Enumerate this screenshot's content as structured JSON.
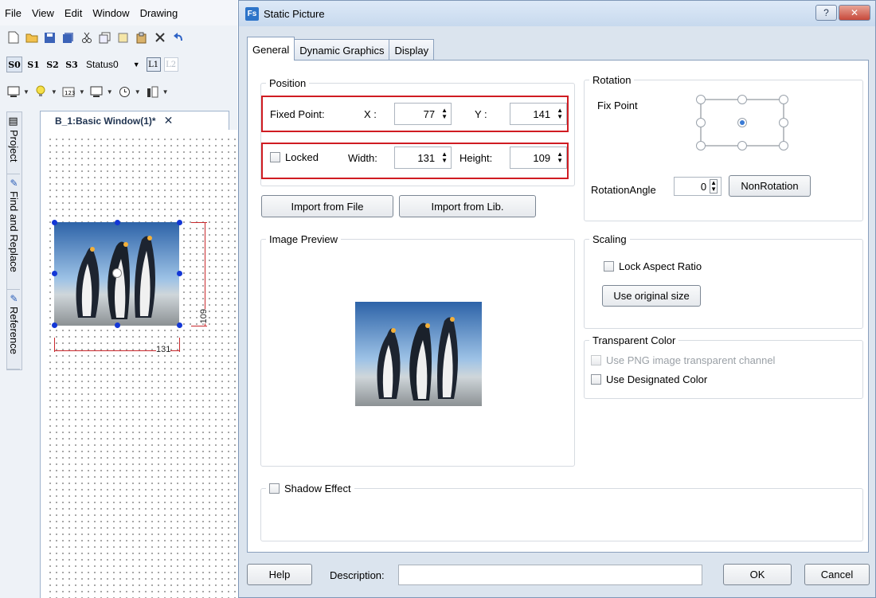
{
  "ide": {
    "menu": [
      "File",
      "View",
      "Edit",
      "Window",
      "Drawing"
    ],
    "status_buttons": [
      "S0",
      "S1",
      "S2",
      "S3"
    ],
    "status_select": "Status0",
    "layer_buttons": [
      "L1",
      "L2"
    ],
    "side_tabs": [
      "Project",
      "Find and Replace",
      "Reference"
    ],
    "doc_tab": "B_1:Basic Window(1)*",
    "canvas": {
      "width_label": "131",
      "height_label": "109"
    }
  },
  "dialog": {
    "title": "Static Picture",
    "app_icon": "Fs",
    "tabs": [
      "General",
      "Dynamic Graphics",
      "Display"
    ],
    "position": {
      "label": "Position",
      "fixed_point": "Fixed Point:",
      "x_label": "X :",
      "x_value": "77",
      "y_label": "Y :",
      "y_value": "141",
      "locked": "Locked",
      "width_label": "Width:",
      "width_value": "131",
      "height_label": "Height:",
      "height_value": "109"
    },
    "import_file": "Import from File",
    "import_lib": "Import from Lib.",
    "image_preview": "Image Preview",
    "rotation": {
      "label": "Rotation",
      "fix_point": "Fix Point",
      "angle_label": "RotationAngle",
      "angle_value": "0",
      "nonrotation": "NonRotation"
    },
    "scaling": {
      "label": "Scaling",
      "lock_aspect": "Lock Aspect Ratio",
      "use_original": "Use original size"
    },
    "transparent": {
      "label": "Transparent Color",
      "png_channel": "Use PNG image transparent channel",
      "designated": "Use Designated Color"
    },
    "shadow": "Shadow Effect",
    "footer": {
      "help": "Help",
      "description_label": "Description:",
      "description_value": "",
      "ok": "OK",
      "cancel": "Cancel"
    }
  },
  "colors": {
    "highlight_red": "#d01c22",
    "handle_blue": "#1337d6",
    "accent": "#3a7bd5"
  }
}
